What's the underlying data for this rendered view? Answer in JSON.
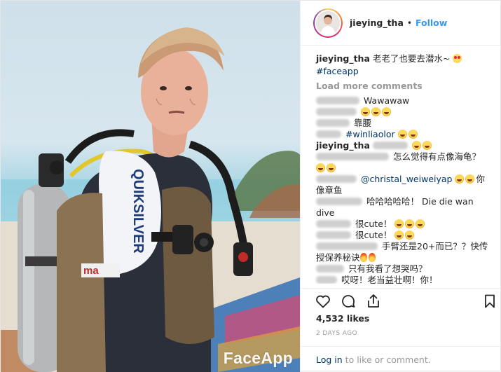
{
  "header": {
    "username": "jieying_tha",
    "separator": "•",
    "follow_label": "Follow",
    "avatar_icon": "profile-photo"
  },
  "caption": {
    "username": "jieying_tha",
    "text": " 老老了也要去潜水~ ",
    "hashtag": "#faceapp"
  },
  "load_more": "Load more comments",
  "comments": [
    {
      "name_blurred": true,
      "text": "Wawawaw",
      "emoji": []
    },
    {
      "name_blurred": true,
      "text": "",
      "emoji": [
        "laugh",
        "laugh",
        "laugh"
      ]
    },
    {
      "name_blurred": true,
      "text": "靠腰",
      "emoji": []
    },
    {
      "name_blurred": true,
      "text": "#winliaolor",
      "emoji": [
        "laugh",
        "laugh"
      ]
    },
    {
      "username": "jieying_tha",
      "text": "",
      "emoji": [
        "laugh",
        "laugh"
      ]
    },
    {
      "name_blurred": true,
      "text": "怎么觉得有点像海龟？",
      "emoji": [
        "laugh",
        "laugh"
      ]
    },
    {
      "name_blurred": true,
      "mention": "@christal_weiweiyap",
      "text": "你像章鱼",
      "emoji": [
        "laugh",
        "laugh"
      ]
    },
    {
      "name_blurred": true,
      "text": "哈哈哈哈哈！ Die die wan dive",
      "emoji": []
    },
    {
      "name_blurred": true,
      "text": "很cute！",
      "emoji": [
        "laugh",
        "laugh",
        "laugh"
      ]
    },
    {
      "name_blurred": true,
      "text": "很cute！",
      "emoji": [
        "laugh",
        "laugh"
      ]
    },
    {
      "name_blurred": true,
      "text": "手臂还是20+而已？？快传授保养秘诀",
      "emoji": [
        "fire",
        "fire"
      ]
    },
    {
      "name_blurred": true,
      "text": "只有我看了想哭吗？",
      "emoji": []
    },
    {
      "name_blurred": true,
      "text": "哎呀！老当益壮啊！你！",
      "emoji": []
    }
  ],
  "actions": {
    "like_icon": "heart-icon",
    "comment_icon": "comment-icon",
    "share_icon": "share-icon",
    "save_icon": "bookmark-icon"
  },
  "likes": "4,532 likes",
  "timestamp": "2 DAYS AGO",
  "login_bar": {
    "link": "Log in",
    "text": " to like or comment."
  },
  "photo": {
    "watermark": "FaceApp",
    "wetsuit_brand": "QUIKSILVER"
  },
  "colors": {
    "follow_blue": "#3897f0",
    "link_navy": "#003569",
    "muted_gray": "#999999"
  }
}
